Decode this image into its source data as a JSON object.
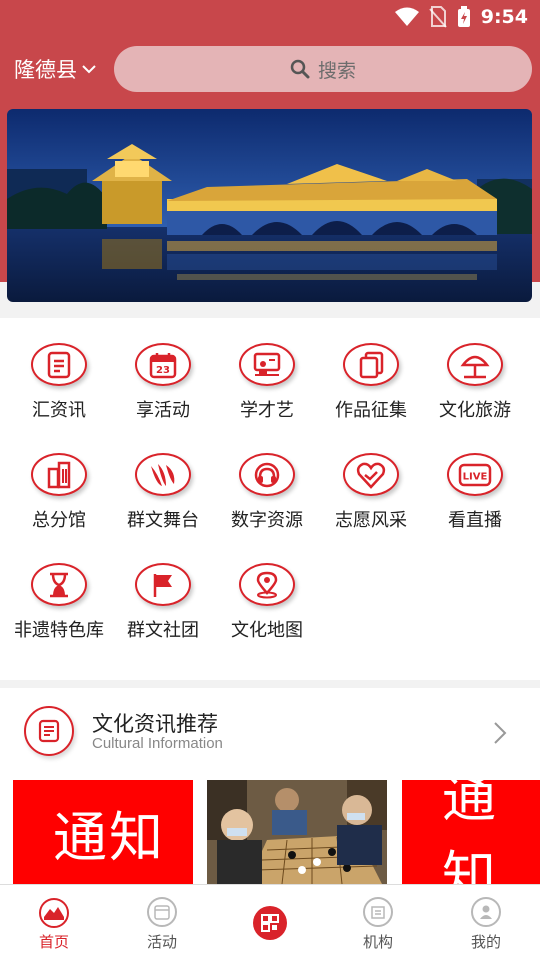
{
  "status": {
    "time": "9:54"
  },
  "header": {
    "location": "隆德县",
    "search_placeholder": "搜索"
  },
  "colors": {
    "accent": "#d9232a",
    "header_bg": "#c8474b",
    "notice_bg": "#ff0000"
  },
  "grid": [
    {
      "label": "汇资讯",
      "icon": "document-icon"
    },
    {
      "label": "享活动",
      "icon": "calendar-icon"
    },
    {
      "label": "学才艺",
      "icon": "classroom-icon"
    },
    {
      "label": "作品征集",
      "icon": "files-icon"
    },
    {
      "label": "文化旅游",
      "icon": "umbrella-icon"
    },
    {
      "label": "总分馆",
      "icon": "building-icon"
    },
    {
      "label": "群文舞台",
      "icon": "stage-icon"
    },
    {
      "label": "数字资源",
      "icon": "headset-icon"
    },
    {
      "label": "志愿风采",
      "icon": "handshake-heart-icon"
    },
    {
      "label": "看直播",
      "icon": "live-icon"
    },
    {
      "label": "非遗特色库",
      "icon": "hourglass-icon"
    },
    {
      "label": "群文社团",
      "icon": "flag-icon"
    },
    {
      "label": "文化地图",
      "icon": "map-pin-icon"
    }
  ],
  "section": {
    "title": "文化资讯推荐",
    "subtitle": "Cultural Information",
    "cards": [
      {
        "type": "notice",
        "text": "通知"
      },
      {
        "type": "photo",
        "text": ""
      },
      {
        "type": "notice",
        "text": "通知"
      }
    ]
  },
  "tabbar": [
    {
      "label": "首页",
      "icon": "home-icon",
      "active": true
    },
    {
      "label": "活动",
      "icon": "activity-icon",
      "active": false
    },
    {
      "label": "",
      "icon": "scan-qr-icon",
      "active": false
    },
    {
      "label": "机构",
      "icon": "organization-icon",
      "active": false
    },
    {
      "label": "我的",
      "icon": "profile-icon",
      "active": false
    }
  ]
}
